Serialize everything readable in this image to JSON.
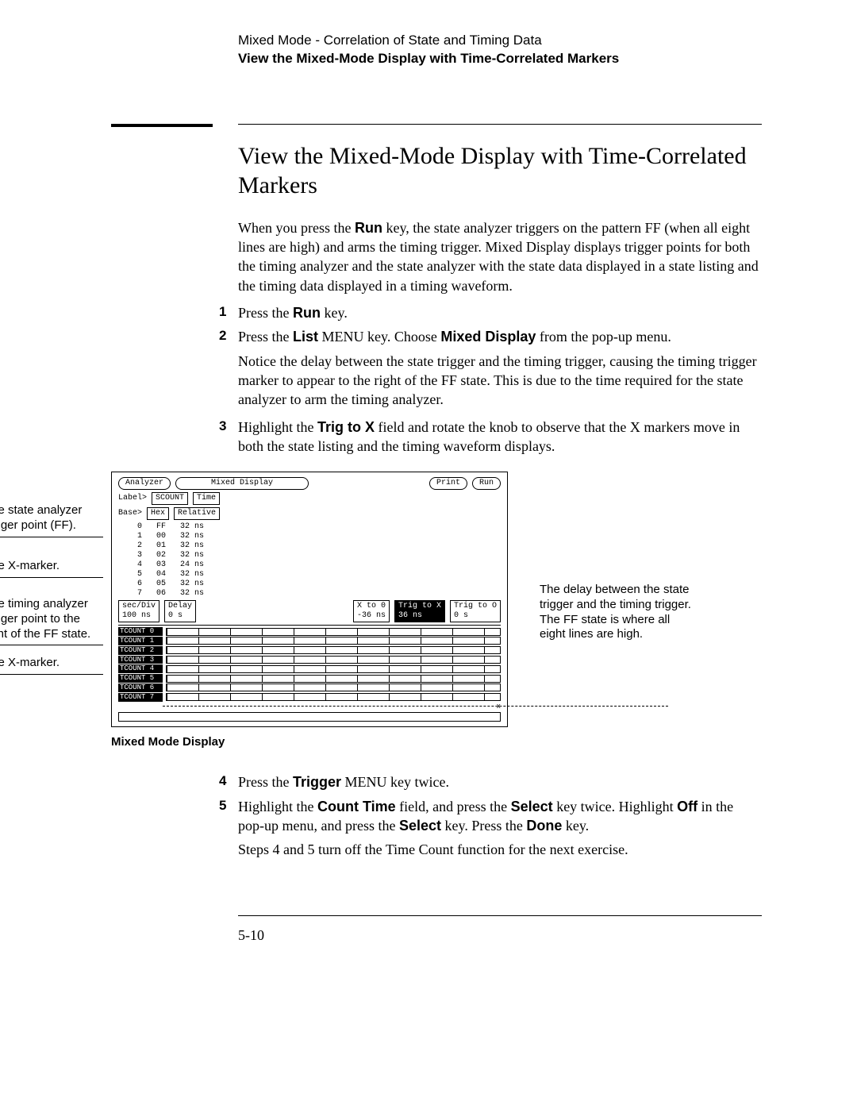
{
  "header": {
    "line1": "Mixed Mode - Correlation of State and Timing Data",
    "line2": "View the Mixed-Mode Display with Time-Correlated Markers"
  },
  "title": "View the Mixed-Mode Display with Time-Correlated Markers",
  "intro_a": "When you press the ",
  "intro_run": "Run",
  "intro_b": " key, the state analyzer triggers on the pattern FF (when all eight lines are high) and arms the timing trigger.  Mixed Display displays trigger points for both the timing analyzer and the state analyzer with the state data displayed in a state listing and the timing data displayed in a timing waveform.",
  "steps": {
    "s1": {
      "num": "1",
      "a": "Press the ",
      "b": "Run",
      "c": " key."
    },
    "s2": {
      "num": "2",
      "a": "Press the ",
      "b": "List",
      "c": " MENU key.  Choose ",
      "d": "Mixed Display",
      "e": " from the pop-up menu.",
      "note": "Notice the delay between the state trigger and the timing trigger, causing the timing trigger marker to appear to the right of the FF state.  This is due to the time required for the state analyzer to arm the timing analyzer."
    },
    "s3": {
      "num": "3",
      "a": "Highlight the ",
      "b": "Trig to X",
      "c": " field and rotate the knob to observe that the X markers move in both the state listing and the timing waveform displays."
    },
    "s4": {
      "num": "4",
      "a": "Press the ",
      "b": "Trigger",
      "c": " MENU key twice."
    },
    "s5": {
      "num": "5",
      "a": "Highlight the ",
      "b": "Count Time",
      "c": " field, and press the ",
      "d": "Select",
      "e": " key twice.  Highlight ",
      "f": "Off",
      "g": " in the pop-up menu, and press the ",
      "h": "Select",
      "i": " key.  Press the ",
      "j": "Done",
      "k": " key.",
      "note": "Steps 4 and 5 turn off the Time Count function for the next exercise."
    }
  },
  "figure": {
    "top_buttons": {
      "analyzer": "Analyzer",
      "mixed": "Mixed Display",
      "print": "Print",
      "run": "Run"
    },
    "label_row": {
      "label": "Label>",
      "scount": "SCOUNT",
      "time": "Time"
    },
    "base_row": {
      "base": "Base>",
      "hex": "Hex",
      "rel": "Relative"
    },
    "listing": [
      "0   FF   32 ns",
      "1   00   32 ns",
      "2   01   32 ns",
      "3   02   32 ns",
      "4   03   24 ns",
      "5   04   32 ns",
      "6   05   32 ns",
      "7   06   32 ns"
    ],
    "mid_boxes": {
      "secdiv": "sec/Div",
      "secdiv_v": "100 ns",
      "delay": "Delay",
      "delay_v": "0   s",
      "xto0": "X to 0",
      "xto0_v": "-36 ns",
      "trigx": "Trig to X",
      "trigx_v": "36 ns",
      "trigo": "Trig to O",
      "trigo_v": "0   s"
    },
    "wave_labels": [
      "TCOUNT 0",
      "TCOUNT 1",
      "TCOUNT 2",
      "TCOUNT 3",
      "TCOUNT 4",
      "TCOUNT 5",
      "TCOUNT 6",
      "TCOUNT 7"
    ],
    "x_marker": "x",
    "caption": "Mixed Mode Display"
  },
  "callouts": {
    "c1": "The state analyzer trigger point (FF).",
    "c2": "The X-marker.",
    "c3": "The timing analyzer trigger point to the right of the FF state.",
    "c4": "The X-marker.",
    "c5": "The delay between the state trigger and the timing trigger.  The FF state is where all eight lines are high."
  },
  "page_number": "5-10"
}
